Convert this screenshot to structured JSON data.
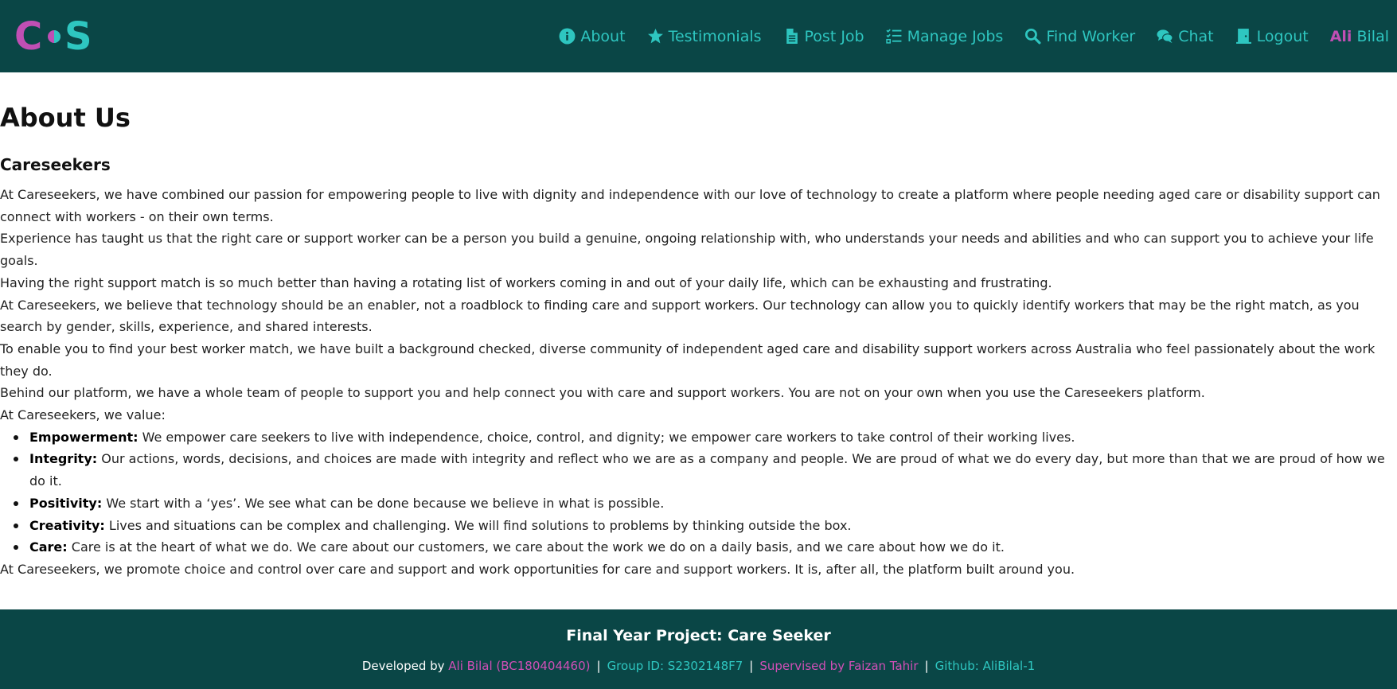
{
  "colors": {
    "nav_bg": "#0a4646",
    "accent_teal": "#2ec6c0",
    "accent_pink": "#c04fb4",
    "page_bg": "#ffffff"
  },
  "logo": {
    "left": "C",
    "right": "S"
  },
  "nav": {
    "items": [
      {
        "label": "About",
        "icon": "info-icon"
      },
      {
        "label": "Testimonials",
        "icon": "star-icon"
      },
      {
        "label": "Post Job",
        "icon": "document-icon"
      },
      {
        "label": "Manage Jobs",
        "icon": "checklist-icon"
      },
      {
        "label": "Find Worker",
        "icon": "search-icon"
      },
      {
        "label": "Chat",
        "icon": "chat-icon"
      },
      {
        "label": "Logout",
        "icon": "door-icon"
      }
    ],
    "user_first": "Ali",
    "user_last": "Bilal"
  },
  "main": {
    "title": "About Us",
    "subtitle": "Careseekers",
    "paragraphs": [
      "At Careseekers, we have combined our passion for empowering people to live with dignity and independence with our love of technology to create a platform where people needing aged care or disability support can connect with workers - on their own terms.",
      "Experience has taught us that the right care or support worker can be a person you build a genuine, ongoing relationship with, who understands your needs and abilities and who can support you to achieve your life goals.",
      "Having the right support match is so much better than having a rotating list of workers coming in and out of your daily life, which can be exhausting and frustrating.",
      "At Careseekers, we believe that technology should be an enabler, not a roadblock to finding care and support workers. Our technology can allow you to quickly identify workers that may be the right match, as you search by gender, skills, experience, and shared interests.",
      "To enable you to find your best worker match, we have built a background checked, diverse community of independent aged care and disability support workers across Australia who feel passionately about the work they do.",
      "Behind our platform, we have a whole team of people to support you and help connect you with care and support workers. You are not on your own when you use the Careseekers platform.",
      "At Careseekers, we value:"
    ],
    "values": [
      {
        "term": "Empowerment:",
        "text": " We empower care seekers to live with independence, choice, control, and dignity; we empower care workers to take control of their working lives."
      },
      {
        "term": "Integrity:",
        "text": " Our actions, words, decisions, and choices are made with integrity and reflect who we are as a company and people. We are proud of what we do every day, but more than that we are proud of how we do it."
      },
      {
        "term": "Positivity:",
        "text": " We start with a ‘yes’. We see what can be done because we believe in what is possible."
      },
      {
        "term": "Creativity:",
        "text": " Lives and situations can be complex and challenging. We will find solutions to problems by thinking outside the box."
      },
      {
        "term": "Care:",
        "text": " Care is at the heart of what we do. We care about our customers, we care about the work we do on a daily basis, and we care about how we do it."
      }
    ],
    "closing": "At Careseekers, we promote choice and control over care and support and work opportunities for care and support workers. It is, after all, the platform built around you."
  },
  "footer": {
    "title": "Final Year Project: Care Seeker",
    "developed_by": "Developed by ",
    "developer": "Ali Bilal (BC180404460)",
    "separator": "|",
    "group": "Group ID: S2302148F7",
    "supervisor": "Supervised by Faizan Tahir",
    "github": "Github: AliBilal-1"
  }
}
